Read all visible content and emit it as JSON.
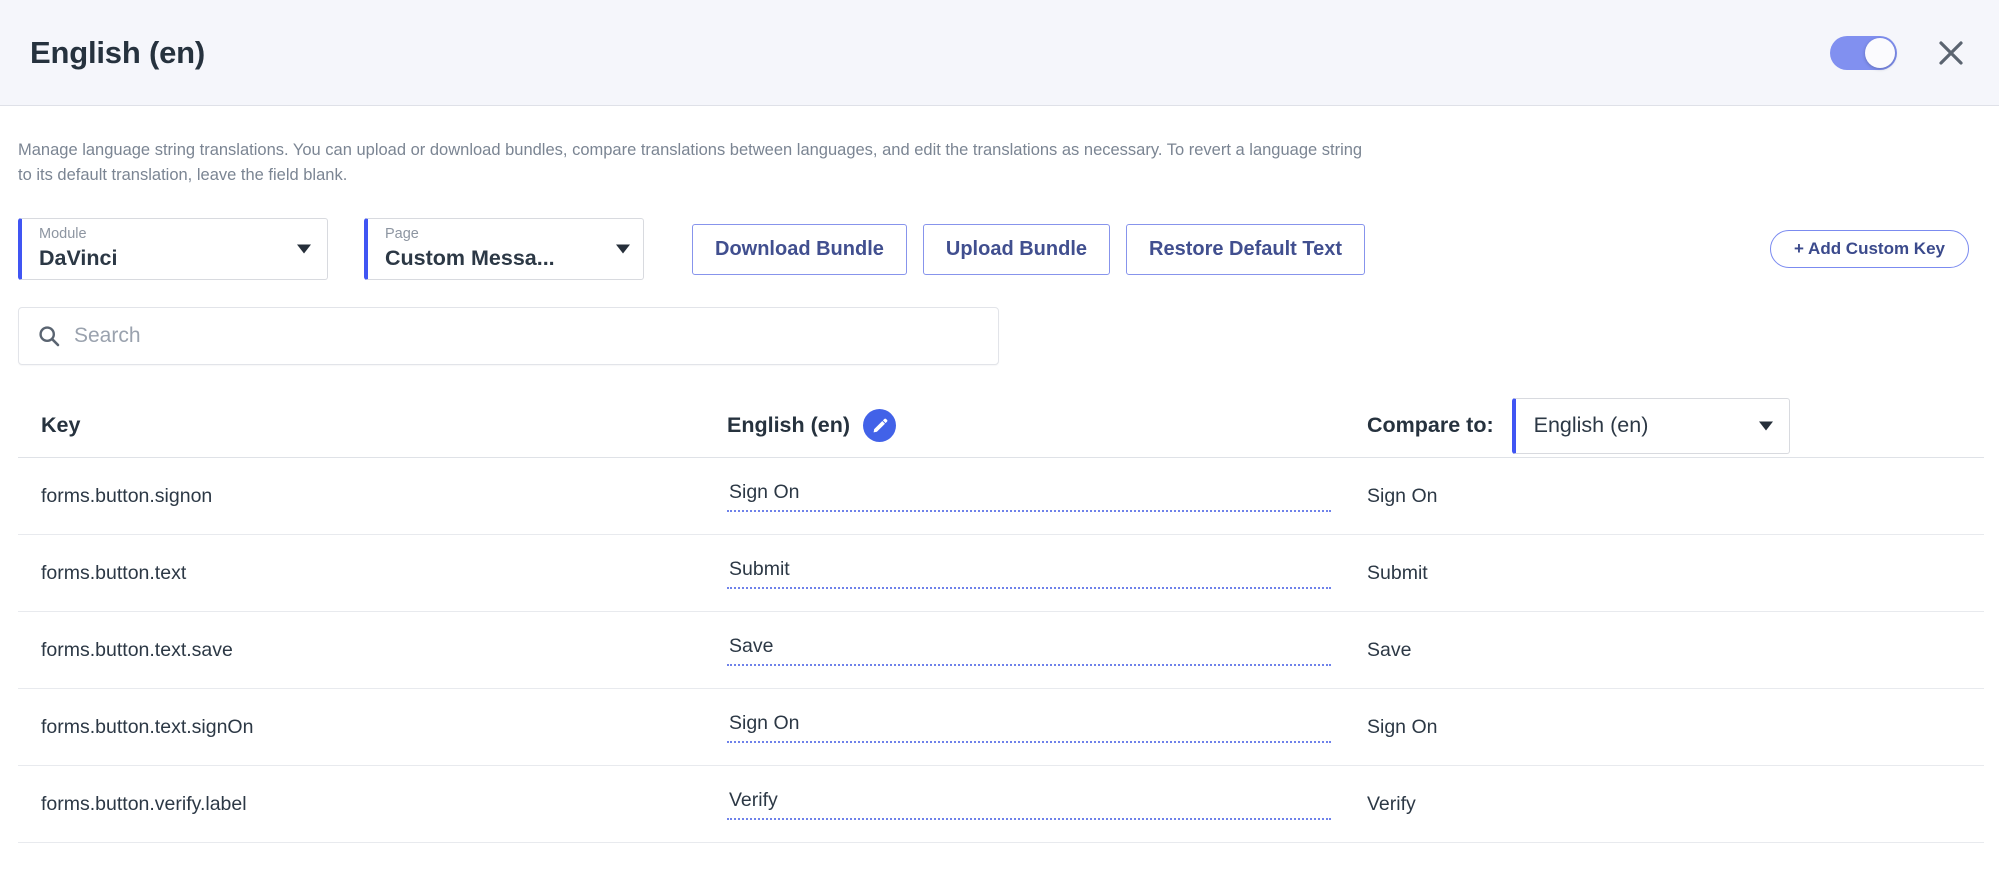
{
  "header": {
    "title": "English (en)",
    "toggle_state": "on",
    "close_icon": "close-icon",
    "accent_color": "#8190f0"
  },
  "description": "Manage language string translations. You can upload or download bundles, compare translations between languages, and edit the translations as necessary. To revert a language string to its default translation, leave the field blank.",
  "controls": {
    "module_select": {
      "label": "Module",
      "value": "DaVinci"
    },
    "page_select": {
      "label": "Page",
      "value": "Custom Messa..."
    },
    "download_bundle": "Download Bundle",
    "upload_bundle": "Upload Bundle",
    "restore_default": "Restore Default Text",
    "add_custom_key": "+ Add Custom Key"
  },
  "search": {
    "placeholder": "Search",
    "value": "",
    "icon": "search-icon"
  },
  "table": {
    "headers": {
      "key": "Key",
      "value": "English (en)",
      "edit_icon": "pencil-icon",
      "compare_label": "Compare to:",
      "compare_value": "English (en)"
    },
    "rows": [
      {
        "key": "forms.button.signon",
        "value": "Sign On",
        "compare": "Sign On"
      },
      {
        "key": "forms.button.text",
        "value": "Submit",
        "compare": "Submit"
      },
      {
        "key": "forms.button.text.save",
        "value": "Save",
        "compare": "Save"
      },
      {
        "key": "forms.button.text.signOn",
        "value": "Sign On",
        "compare": "Sign On"
      },
      {
        "key": "forms.button.verify.label",
        "value": "Verify",
        "compare": "Verify"
      }
    ]
  },
  "colors": {
    "accent_blue": "#4055f3",
    "header_bg": "#f5f6fb",
    "edit_badge": "#4262e8",
    "dotted_underline": "#6f82ea"
  }
}
